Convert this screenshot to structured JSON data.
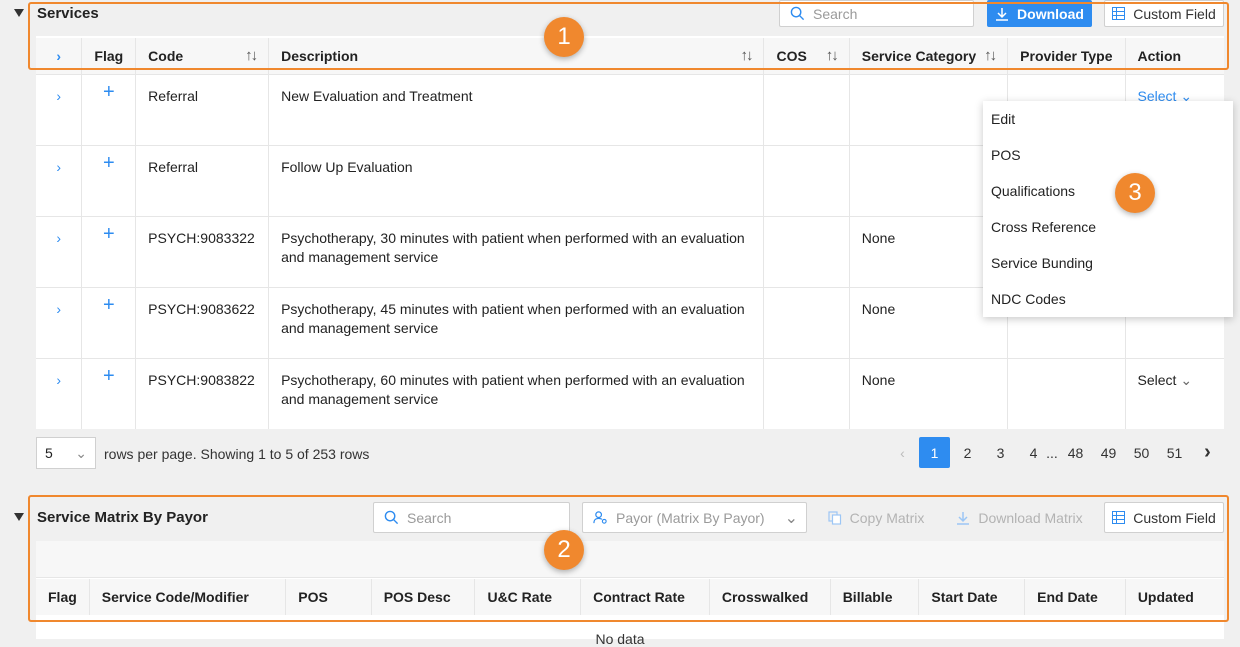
{
  "services": {
    "title": "Services",
    "search_placeholder": "Search",
    "download_label": "Download",
    "custom_field_label": "Custom Field",
    "columns": {
      "flag": "Flag",
      "code": "Code",
      "description": "Description",
      "cos": "COS",
      "service_category": "Service Category",
      "provider_type": "Provider Type",
      "action": "Action"
    },
    "rows": [
      {
        "code": "Referral",
        "description": "New Evaluation and Treatment",
        "cos": "",
        "service_category": "",
        "provider_type": "",
        "action": "Select"
      },
      {
        "code": "Referral",
        "description": "Follow Up Evaluation",
        "cos": "",
        "service_category": "",
        "provider_type": "",
        "action": ""
      },
      {
        "code": "PSYCH:9083322",
        "description": "Psychotherapy, 30 minutes with patient when performed with an evaluation and management service",
        "cos": "",
        "service_category": "None",
        "provider_type": "",
        "action": ""
      },
      {
        "code": "PSYCH:9083622",
        "description": "Psychotherapy, 45 minutes with patient when performed with an evaluation and management service",
        "cos": "",
        "service_category": "None",
        "provider_type": "",
        "action": ""
      },
      {
        "code": "PSYCH:9083822",
        "description": "Psychotherapy, 60 minutes with patient when performed with an evaluation and management service",
        "cos": "",
        "service_category": "None",
        "provider_type": "",
        "action": "Select"
      }
    ],
    "action_menu": [
      "Edit",
      "POS",
      "Qualifications",
      "Cross Reference",
      "Service Bunding",
      "NDC Codes"
    ],
    "pagination": {
      "rows_per_page": "5",
      "summary": "rows per page. Showing 1 to 5 of 253 rows",
      "pages": [
        "1",
        "2",
        "3",
        "4",
        "...",
        "48",
        "49",
        "50",
        "51"
      ],
      "active_page": "1"
    }
  },
  "matrix": {
    "title": "Service Matrix By Payor",
    "search_placeholder": "Search",
    "payor_placeholder": "Payor (Matrix By Payor)",
    "copy_label": "Copy Matrix",
    "download_label": "Download Matrix",
    "custom_field_label": "Custom Field",
    "columns": [
      "Flag",
      "Service Code/Modifier",
      "POS",
      "POS Desc",
      "U&C Rate",
      "Contract Rate",
      "Crosswalked",
      "Billable",
      "Start Date",
      "End Date",
      "Updated"
    ],
    "empty_text": "No data"
  },
  "annotations": [
    "1",
    "2",
    "3"
  ],
  "colors": {
    "accent": "#2e8cf0",
    "annotation": "#f0882e"
  }
}
